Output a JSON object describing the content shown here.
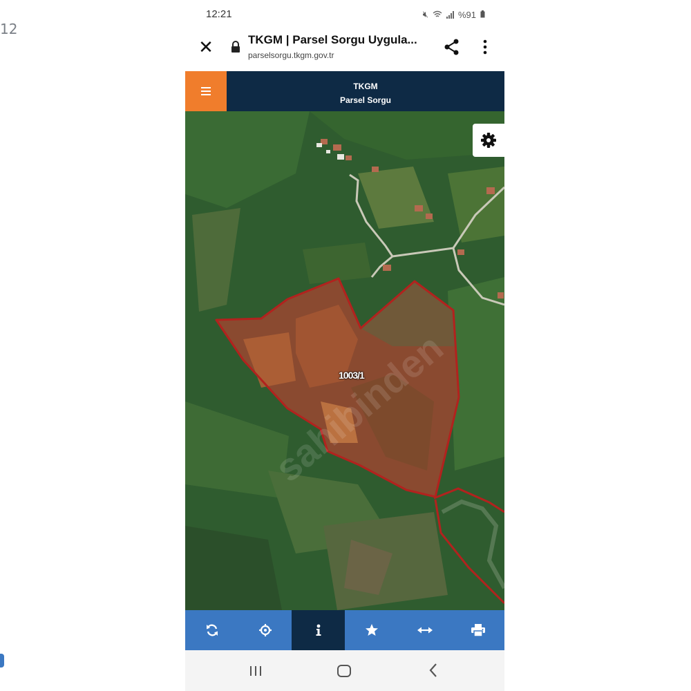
{
  "edge": {
    "left_text": "12"
  },
  "status_bar": {
    "time": "12:21",
    "battery_text": "%91"
  },
  "browser": {
    "title": "TKGM | Parsel Sorgu Uygula...",
    "url": "parselsorgu.tkgm.gov.tr",
    "icons": {
      "close": "close-icon",
      "lock": "lock-icon",
      "share": "share-icon",
      "more": "more-vert-icon"
    }
  },
  "app_header": {
    "line1": "TKGM",
    "line2": "Parsel Sorgu",
    "menu_icon": "hamburger-icon",
    "accent": "#f07d2c",
    "background": "#0e2a45"
  },
  "map": {
    "parcel_label": "1003/1",
    "parcel_border_color": "#b2221e",
    "settings_icon": "gear-icon"
  },
  "toolbar": {
    "background": "#3b78c2",
    "active_background": "#0e2a45",
    "buttons": [
      {
        "icon": "refresh-icon",
        "active": false
      },
      {
        "icon": "locate-icon",
        "active": false
      },
      {
        "icon": "info-icon",
        "active": true
      },
      {
        "icon": "star-icon",
        "active": false
      },
      {
        "icon": "measure-icon",
        "active": false
      },
      {
        "icon": "print-icon",
        "active": false
      }
    ]
  },
  "nav_bar": {
    "icons": [
      "recents-icon",
      "home-icon",
      "back-icon"
    ]
  }
}
